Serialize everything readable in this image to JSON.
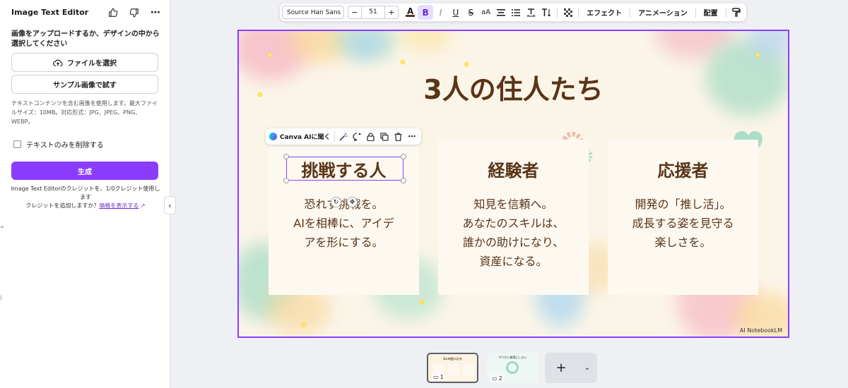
{
  "panel": {
    "title": "Image Text Editor",
    "prompt": "画像をアップロードするか、デザインの中から選択してください",
    "choose_file": "ファイルを選択",
    "try_sample": "サンプル画像で試す",
    "info": "テキストコンテンツを含む画像を使用します。最大ファイルサイズ：10MB。対応形式：JPG、JPEG、PNG、WEBP。",
    "remove_text_only": "テキストのみを削除する",
    "generate": "生成",
    "credit_note": "Image Text Editorのクレジットを、1/0クレジット使用します",
    "credit_add": "クレジットを追加しますか？",
    "price_link": "価格を表示する"
  },
  "toolbar": {
    "font": "Source Han Sans ...",
    "size": "51",
    "minus": "−",
    "plus": "+",
    "effects": "エフェクト",
    "animation": "アニメーション",
    "position": "配置"
  },
  "aibar": {
    "ask": "Canva AIに聞く"
  },
  "slide": {
    "title": "3人の住人たち",
    "cards": [
      {
        "head": "挑戦する人",
        "body": [
          "恐れず挑戦を。",
          "AIを相棒に、アイデ",
          "アを形にする。"
        ]
      },
      {
        "head": "経験者",
        "body": [
          "知見を信頼へ。",
          "あなたのスキルは、",
          "誰かの助けになり、",
          "資産になる。"
        ]
      },
      {
        "head": "応援者",
        "body": [
          "開発の「推し活」。",
          "成長する姿を見守る",
          "楽しさを。"
        ]
      }
    ],
    "brand": "AI NotebookLM"
  },
  "pages": [
    {
      "num": "1",
      "title": "3人の住人たち"
    },
    {
      "num": "2",
      "title": "やりがい循環にしない"
    }
  ],
  "colors": {
    "accent": "#8b3dff",
    "title_brown": "#5a3417"
  }
}
